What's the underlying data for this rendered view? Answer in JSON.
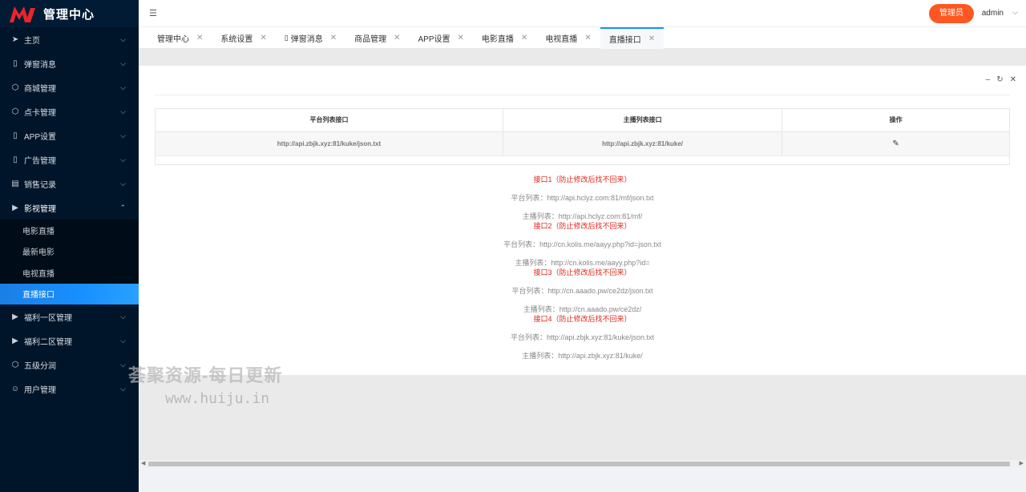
{
  "brand": {
    "title": "管理中心",
    "accent": "#e8252b"
  },
  "sidebar": {
    "items": [
      {
        "label": "主页",
        "icon": "send-icon"
      },
      {
        "label": "弹窗消息",
        "icon": "mobile-icon"
      },
      {
        "label": "商城管理",
        "icon": "cube-icon"
      },
      {
        "label": "点卡管理",
        "icon": "cube-icon"
      },
      {
        "label": "APP设置",
        "icon": "mobile-icon"
      },
      {
        "label": "广告管理",
        "icon": "mobile-icon"
      },
      {
        "label": "销售记录",
        "icon": "list-icon"
      },
      {
        "label": "影视管理",
        "icon": "video-icon"
      }
    ],
    "submenu": [
      {
        "label": "电影直播"
      },
      {
        "label": "最新电影"
      },
      {
        "label": "电视直播"
      },
      {
        "label": "直播接口"
      }
    ],
    "items_after": [
      {
        "label": "福利一区管理",
        "icon": "video-icon"
      },
      {
        "label": "福利二区管理",
        "icon": "video-icon"
      },
      {
        "label": "五级分润",
        "icon": "cube-icon"
      },
      {
        "label": "用户管理",
        "icon": "user-icon"
      }
    ]
  },
  "header": {
    "role_button": "管理员",
    "username": "admin"
  },
  "tabs": [
    {
      "label": "管理中心"
    },
    {
      "label": "系统设置"
    },
    {
      "label": "弹窗消息"
    },
    {
      "label": "商品管理"
    },
    {
      "label": "APP设置"
    },
    {
      "label": "电影直播"
    },
    {
      "label": "电视直播"
    },
    {
      "label": "直播接口"
    }
  ],
  "table": {
    "headers": [
      "平台列表接口",
      "主播列表接口",
      "操作"
    ],
    "rows": [
      {
        "platform": "http://api.zbjk.xyz:81/kuke/json.txt",
        "anchor": "http://api.zbjk.xyz:81/kuke/"
      }
    ]
  },
  "interfaces": [
    {
      "title": "接口1（防止修改后找不回来）",
      "platform": "平台列表：http://api.hclyz.com:81/mf/json.txt",
      "anchor": "主播列表：http://api.hclyz.com:81/mf/"
    },
    {
      "title": "接口2（防止修改后找不回来）",
      "platform": "平台列表：http://cn.kolis.me/aayy.php?id=json.txt",
      "anchor": "主播列表：http://cn.kolis.me/aayy.php?id="
    },
    {
      "title": "接口3（防止修改后找不回来）",
      "platform": "平台列表：http://cn.aaado.pw/ce2dz/json.txt",
      "anchor": "主播列表：http://cn.aaado.pw/ce2dz/"
    },
    {
      "title": "接口4（防止修改后找不回来）",
      "platform": "平台列表：http://api.zbjk.xyz:81/kuke/json.txt",
      "anchor": "主播列表：http://api.zbjk.xyz:81/kuke/"
    }
  ],
  "watermark": {
    "line1": "荟聚资源-每日更新",
    "line2": "www.huiju.in"
  },
  "colors": {
    "sidebar_bg": "#001529",
    "active_item": "#1890ff",
    "role_button": "#ff5722",
    "interface_title": "#e1251b"
  }
}
